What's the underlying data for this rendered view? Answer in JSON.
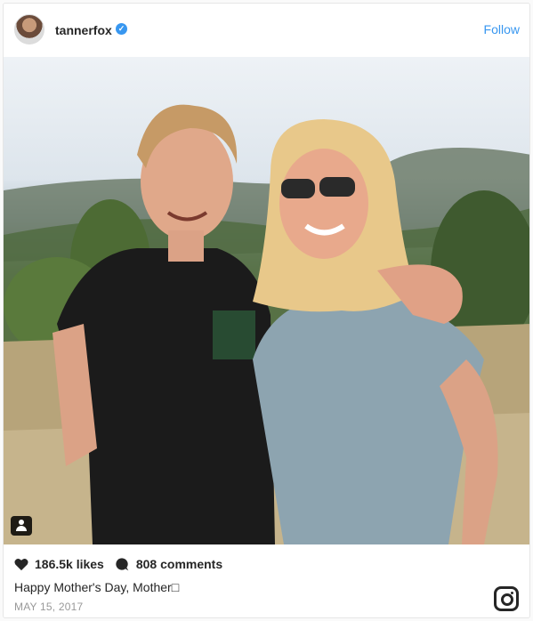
{
  "post": {
    "username": "tannerfox",
    "verified": true,
    "follow_label": "Follow",
    "likes": "186.5k likes",
    "comments": "808 comments",
    "caption": "Happy Mother's Day, Mother□",
    "date": "MAY 15, 2017"
  },
  "icons": {
    "verified": "verified-badge-icon",
    "tag": "user-tag-icon",
    "like": "heart-icon",
    "comment": "comment-bubble-icon",
    "brand": "instagram-logo-icon"
  },
  "colors": {
    "accent": "#3897f0",
    "text": "#262626",
    "muted": "#999999"
  }
}
